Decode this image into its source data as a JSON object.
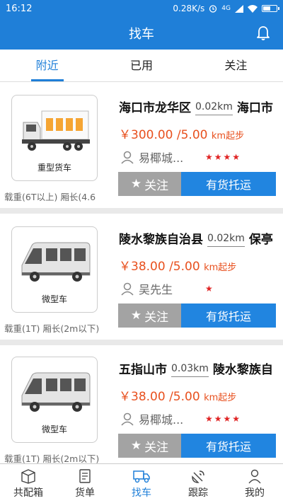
{
  "status_bar": {
    "time": "16:12",
    "speed": "0.28K/s",
    "network": "4G",
    "battery_level": 0.6
  },
  "header": {
    "title": "找车",
    "icon": "bell-icon"
  },
  "tabs": [
    {
      "label": "附近",
      "active": true
    },
    {
      "label": "已用",
      "active": false
    },
    {
      "label": "关注",
      "active": false
    }
  ],
  "cards": [
    {
      "truck_name": "重型货车",
      "spec": "载重(6T以上) 厢长(4.6",
      "from": "海口市龙华区",
      "distance": "0.02km",
      "to": "海口市",
      "price": "￥300.00 /5.00",
      "price_unit": "km起步",
      "owner": "易椰城...",
      "stars": "★★★★",
      "follow_label": "关注",
      "consign_label": "有货托运"
    },
    {
      "truck_name": "微型车",
      "spec": "载重(1T) 厢长(2m以下)",
      "from": "陵水黎族自治县",
      "distance": "0.02km",
      "to": "保亭",
      "price": "￥38.00 /5.00",
      "price_unit": "km起步",
      "owner": "吴先生",
      "stars": "★",
      "follow_label": "关注",
      "consign_label": "有货托运"
    },
    {
      "truck_name": "微型车",
      "spec": "载重(1T) 厢长(2m以下)",
      "from": "五指山市",
      "distance": "0.03km",
      "to": "陵水黎族自",
      "price": "￥38.00 /5.00",
      "price_unit": "km起步",
      "owner": "易椰城...",
      "stars": "★★★★",
      "follow_label": "关注",
      "consign_label": "有货托运"
    }
  ],
  "bottom_nav": [
    {
      "label": "共配箱",
      "icon": "box-icon",
      "active": false
    },
    {
      "label": "货单",
      "icon": "document-icon",
      "active": false
    },
    {
      "label": "找车",
      "icon": "truck-icon",
      "active": true
    },
    {
      "label": "跟踪",
      "icon": "satellite-icon",
      "active": false
    },
    {
      "label": "我的",
      "icon": "person-icon",
      "active": false
    }
  ],
  "colors": {
    "primary": "#1f7fd8",
    "price": "#e8501e",
    "star": "#e02424",
    "follow_btn": "#a3a3a3",
    "consign_btn": "#2185e0"
  }
}
